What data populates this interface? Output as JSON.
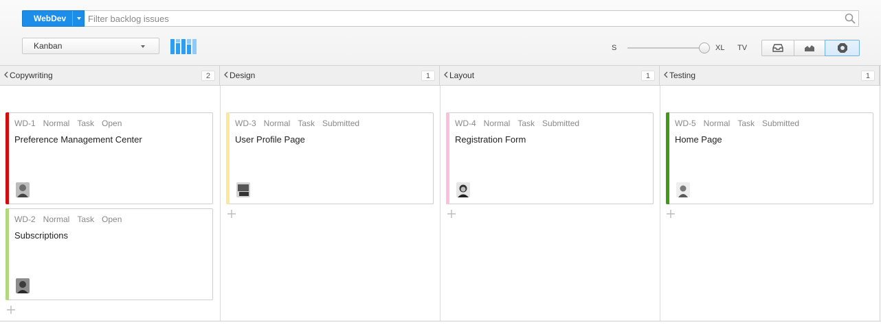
{
  "toolbar": {
    "project_label": "WebDev",
    "search_placeholder": "Filter backlog issues",
    "board_label": "Kanban",
    "size_small_label": "S",
    "size_large_label": "XL",
    "size_tv_label": "TV",
    "card_size_level": 1.0
  },
  "columns": [
    {
      "title": "Copywriting",
      "count": "2"
    },
    {
      "title": "Design",
      "count": "1"
    },
    {
      "title": "Layout",
      "count": "1"
    },
    {
      "title": "Testing",
      "count": "1"
    }
  ],
  "cards": [
    {
      "column": 0,
      "id": "WD-1",
      "priority": "Normal",
      "type": "Task",
      "state": "Open",
      "title": "Preference Management Center",
      "stripe_color": "#d10f0f",
      "avatar_icon": "user-avatar-icon"
    },
    {
      "column": 0,
      "id": "WD-2",
      "priority": "Normal",
      "type": "Task",
      "state": "Open",
      "title": "Subscriptions",
      "stripe_color": "#b3d87f",
      "avatar_icon": "user-avatar-icon"
    },
    {
      "column": 1,
      "id": "WD-3",
      "priority": "Normal",
      "type": "Task",
      "state": "Submitted",
      "title": "User Profile Page",
      "stripe_color": "#fbe99a",
      "avatar_icon": "user-avatar-icon"
    },
    {
      "column": 2,
      "id": "WD-4",
      "priority": "Normal",
      "type": "Task",
      "state": "Submitted",
      "title": "Registration Form",
      "stripe_color": "#f6c2dd",
      "avatar_icon": "user-avatar-icon"
    },
    {
      "column": 3,
      "id": "WD-5",
      "priority": "Normal",
      "type": "Task",
      "state": "Submitted",
      "title": "Home Page",
      "stripe_color": "#3f9b13",
      "avatar_icon": "user-avatar-icon"
    }
  ],
  "colors": {
    "accent": "#1c8ee9",
    "chart_bars": "#2d9ff0"
  }
}
